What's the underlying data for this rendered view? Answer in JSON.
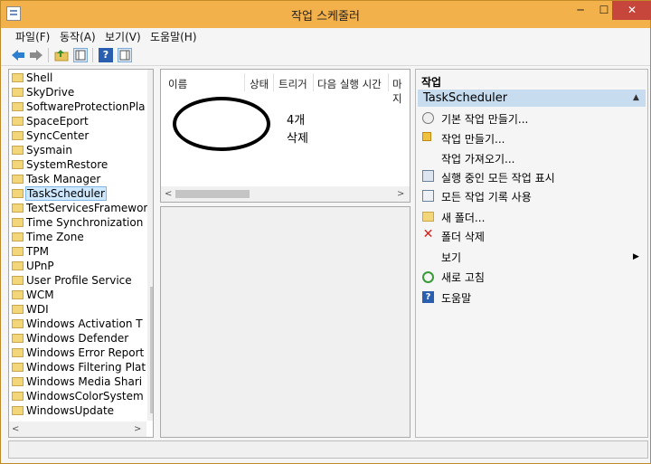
{
  "window": {
    "title": "작업 스케줄러"
  },
  "titlebar_buttons": {
    "minimize": "─",
    "maximize": "☐",
    "close": "✕"
  },
  "menu": [
    "파일(F)",
    "동작(A)",
    "보기(V)",
    "도움말(H)"
  ],
  "toolbar": {
    "icons": [
      "back-arrow-icon",
      "forward-arrow-icon",
      "up-folder-icon",
      "show-hide-tree-icon",
      "help-icon",
      "show-hide-action-pane-icon"
    ]
  },
  "tree": {
    "items": [
      "Shell",
      "SkyDrive",
      "SoftwareProtectionPla",
      "SpaceEport",
      "SyncCenter",
      "Sysmain",
      "SystemRestore",
      "Task Manager",
      "TaskScheduler",
      "TextServicesFramewor",
      "Time Synchronization",
      "Time Zone",
      "TPM",
      "UPnP",
      "User Profile Service",
      "WCM",
      "WDI",
      "Windows Activation T",
      "Windows Defender",
      "Windows Error Report",
      "Windows Filtering Plat",
      "Windows Media Shari",
      "WindowsColorSystem",
      "WindowsUpdate"
    ],
    "selected": "TaskScheduler"
  },
  "task_list": {
    "columns": [
      "이름",
      "상태",
      "트리거",
      "다음 실행 시간",
      "마지"
    ],
    "annotation_lines": [
      "4개",
      "삭제"
    ]
  },
  "actions": {
    "header": "작업",
    "section_title": "TaskScheduler",
    "items": [
      {
        "label": "기본 작업 만들기...",
        "icon": "create-basic-task-icon"
      },
      {
        "label": "작업 만들기...",
        "icon": "create-task-icon"
      },
      {
        "label": "작업 가져오기...",
        "icon": ""
      },
      {
        "label": "실행 중인 모든 작업 표시",
        "icon": "running-tasks-icon"
      },
      {
        "label": "모든 작업 기록 사용",
        "icon": "history-icon"
      },
      {
        "label": "새 폴더...",
        "icon": "new-folder-icon"
      },
      {
        "label": "폴더 삭제",
        "icon": "delete-icon"
      },
      {
        "label": "보기",
        "icon": ""
      },
      {
        "label": "새로 고침",
        "icon": "refresh-icon"
      },
      {
        "label": "도움말",
        "icon": "help-icon"
      }
    ]
  },
  "colors": {
    "titlebar": "#f3b14b",
    "selection": "#cde8ff",
    "action_band": "#c7dcef",
    "close_button": "#c7463b"
  }
}
